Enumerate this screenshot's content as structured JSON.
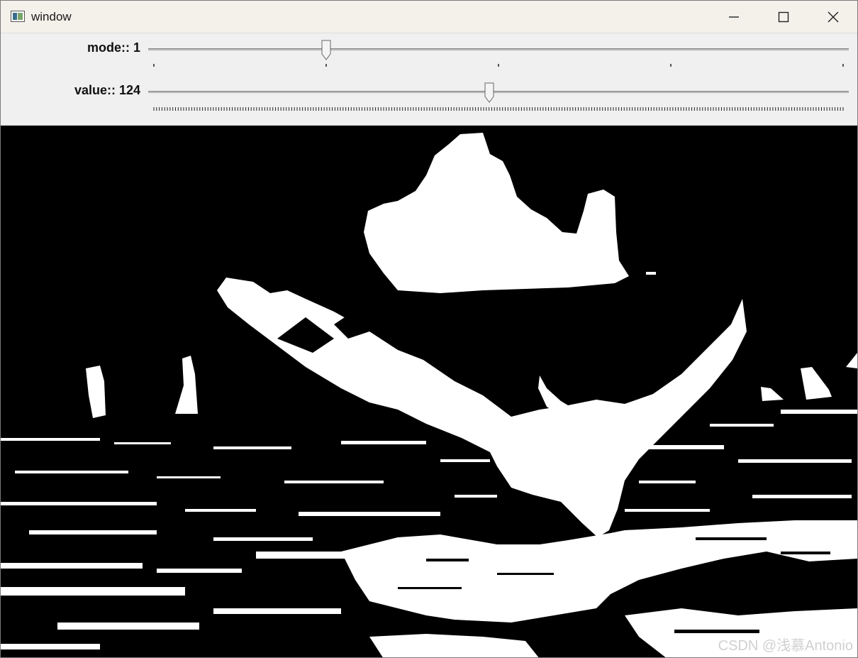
{
  "window": {
    "title": "window"
  },
  "trackbars": [
    {
      "label": "mode:: 1",
      "value": 1,
      "min": 0,
      "max": 4,
      "tick_count": 5
    },
    {
      "label": "value:: 124",
      "value": 124,
      "min": 0,
      "max": 255,
      "tick_count": 256
    }
  ],
  "icons": {
    "app": "app-window-icon",
    "minimize": "minimize-icon",
    "maximize": "maximize-icon",
    "close": "close-icon"
  },
  "watermark": "CSDN @浅慕Antonio",
  "colors": {
    "titlebar": "#f3f1ea",
    "panel": "#f0f0f0",
    "image_foreground": "#ffffff",
    "image_background": "#000000"
  }
}
